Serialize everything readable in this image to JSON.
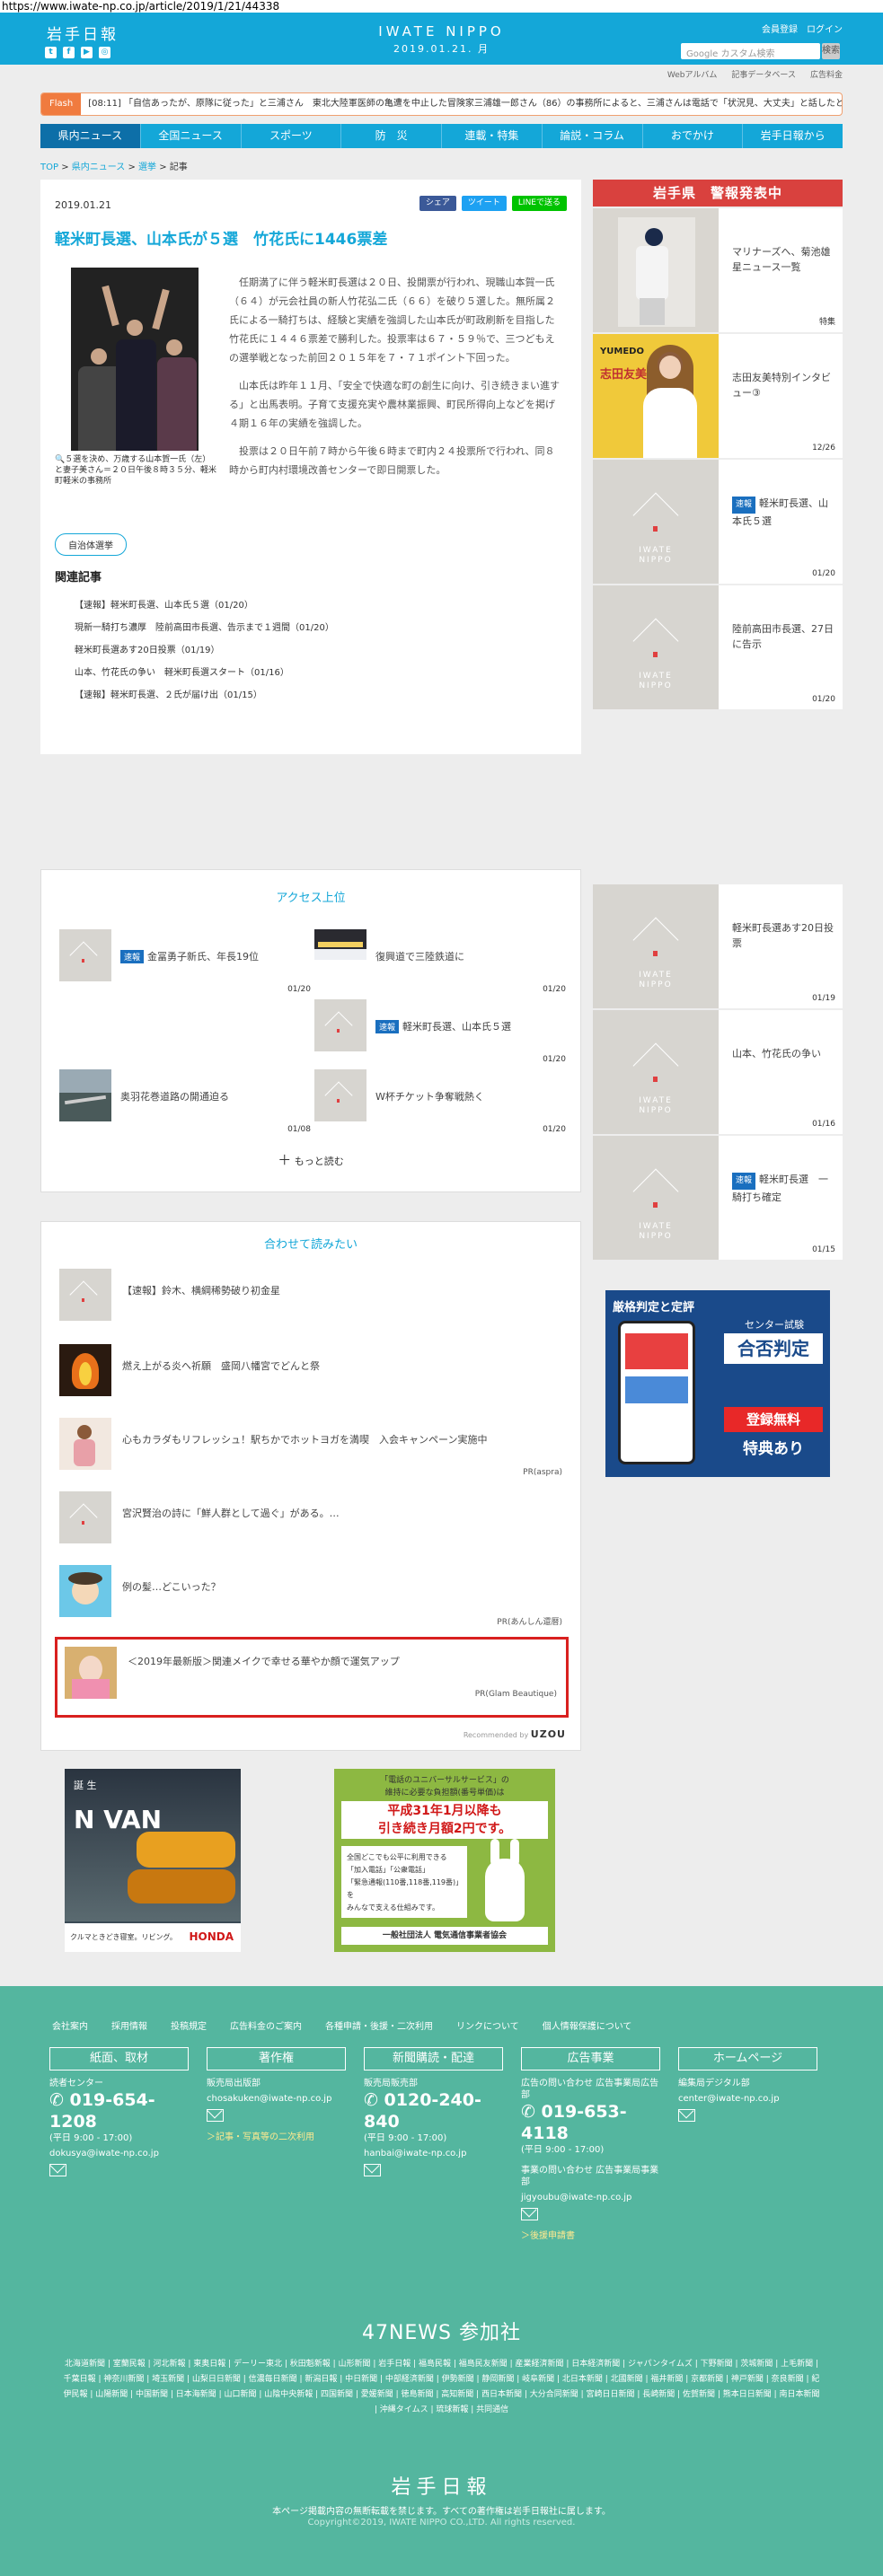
{
  "browser": {
    "url": "https://www.iwate-np.co.jp/article/2019/1/21/44338"
  },
  "header": {
    "logo": "岩手日報",
    "site_name": "IWATE NIPPO",
    "date": "2019.01.21. 月",
    "login_links": [
      "会員登録",
      "ログイン"
    ],
    "search_placeholder": "Google カスタム検索",
    "search_button": "検索",
    "sub_links": [
      "Webアルバム",
      "記事データベース",
      "広告料金"
    ]
  },
  "flash": {
    "label": "Flash",
    "text": "[08:11] 「自信あったが、原隊に従った」と三浦さん　東北大陸軍医師の亀遭を中止した冒険家三浦雄一郎さん（86）の事務所によると、三浦さんは電話で「状況見、大丈夫」と話したという。"
  },
  "nav": {
    "items": [
      "県内ニュース",
      "全国ニュース",
      "スポーツ",
      "防　災",
      "連載・特集",
      "論説・コラム",
      "おでかけ",
      "岩手日報から"
    ],
    "active_index": 0
  },
  "breadcrumb": {
    "top": "TOP",
    "cat": "県内ニュース",
    "sub": "選挙",
    "current": "記事"
  },
  "article": {
    "date": "2019.01.21",
    "share": [
      "シェア",
      "ツイート",
      "LINEで送る"
    ],
    "title": "軽米町長選、山本氏が５選　竹花氏に1446票差",
    "caption": "５選を決め、万歳する山本賀一氏（左）と妻子美さん＝２０日午後８時３５分、軽米町軽米の事務所",
    "paragraphs": [
      "任期満了に伴う軽米町長選は２０日、投開票が行われ、現職山本賀一氏（６４）が元会社員の新人竹花弘二氏（６６）を破り５選した。無所属２氏による一騎打ちは、経験と実績を強調した山本氏が町政刷新を目指した竹花氏に１４４６票差で勝利した。投票率は６７・５９％で、三つどもえの選挙戦となった前回２０１５年を７・７１ポイント下回った。",
      "山本氏は昨年１１月、「安全で快適な町の創生に向け、引き続きまい進する」と出馬表明。子育て支援充実や農林業振興、町民所得向上などを掲げ４期１６年の実績を強調した。",
      "投票は２０日午前７時から午後６時まで町内２４投票所で行われ、同８時から町内村環境改善センターで即日開票した。"
    ],
    "tag": "自治体選挙",
    "related_heading": "関連記事",
    "related": [
      "【速報】軽米町長選、山本氏５選（01/20）",
      "現新一騎打ち濃厚　陸前高田市長選、告示まで１週間（01/20）",
      "軽米町長選あす20日投票（01/19）",
      "山本、竹花氏の争い　軽米町長選スタート（01/16）",
      "【速報】軽米町長選、２氏が届け出（01/15）"
    ]
  },
  "sidebar": {
    "alert": "岩手県　警報発表中",
    "items": [
      {
        "text": "マリナーズへ、菊池雄星ニュース一覧",
        "date": "特集"
      },
      {
        "text": "志田友美特別インタビュー③",
        "date": "12/26"
      },
      {
        "badge": "速報",
        "text": "軽米町長選、山本氏５選",
        "date": "01/20"
      },
      {
        "text": "陸前高田市長選、27日に告示",
        "date": "01/20"
      }
    ],
    "items2": [
      {
        "text": "軽米町長選あす20日投票",
        "date": "01/19"
      },
      {
        "text": "山本、竹花氏の争い",
        "date": "01/16"
      },
      {
        "badge": "速報",
        "text": "軽米町長選　一騎打ち確定",
        "date": "01/15"
      }
    ],
    "placeholder_label_1": "IWATE",
    "placeholder_label_2": "NIPPO",
    "yumedo_logo": "YUMEDO",
    "yumedo_name": "志田友美",
    "ad_top": "厳格判定と定評",
    "ad_title": "合否判定",
    "ad_sub": "センター試験",
    "ad_cta1": "登録無料",
    "ad_cta2": "特典あり"
  },
  "access": {
    "heading": "アクセス上位",
    "items": [
      {
        "badge": "速報",
        "text": "金冨勇子新氏、年長19位",
        "date": "01/20"
      },
      {
        "text": "復興道で三陸鉄道に",
        "date": "01/20"
      },
      {
        "badge": "速報",
        "text": "軽米町長選、山本氏５選",
        "date": "01/20"
      },
      {
        "text": "奥羽花巻道路の開通迫る",
        "date": "01/08"
      },
      {
        "text": "W杯チケット争奪戦熱く",
        "date": "01/20"
      }
    ],
    "more": "もっと読む"
  },
  "recommend": {
    "heading": "合わせて読みたい",
    "items": [
      {
        "text": "【速報】鈴木、横綱稀勢破り初金星",
        "pr": ""
      },
      {
        "text": "燃え上がる炎へ祈願　盛岡八幡宮でどんと祭",
        "pr": ""
      },
      {
        "text": "心もカラダもリフレッシュ！駅ちかでホットヨガを満喫　入会キャンペーン実施中",
        "pr": "PR(aspra)"
      },
      {
        "text": "宮沢賢治の詩に「鮮人群として過ぐ」がある。…",
        "pr": ""
      },
      {
        "text": "例の髪…どこいった？",
        "pr": "PR(あんしん還暦)"
      },
      {
        "text": "＜2019年最新版＞関連メイクで幸せる華やか顔で運気アップ",
        "pr": "PR(Glam Beautique)"
      }
    ],
    "powered": "Recommended by",
    "powered_brand": "UZOU"
  },
  "ads": {
    "honda_brand": "HONDA",
    "honda_model": "N VAN",
    "honda_tagline": "クルマときどき寝室。リビング。",
    "honda_sub": "誕 生",
    "univ_text1": "「電話のユニバーサルサービス」の",
    "univ_text2": "維持に必要な負担額(番号単価)は",
    "univ_text3": "平成31年1月以降も",
    "univ_text4": "引き続き月額2円です。",
    "univ_text5": "全国どこでも公平に利用できる",
    "univ_text6": "「加入電話」「公衆電話」",
    "univ_text7": "「緊急通報(110番,118番,119番)」を",
    "univ_text8": "みんなで支える仕組みです。",
    "univ_org": "一般社団法人 電気通信事業者協会"
  },
  "footer": {
    "nav": [
      "会社案内",
      "採用情報",
      "投稿規定",
      "広告料金のご案内",
      "各種申請・後援・二次利用",
      "リンクについて",
      "個人情報保護について"
    ],
    "boxes": [
      {
        "title": "紙面、取材",
        "label": "読者センター",
        "phone": "019-654-1208",
        "hours": "(平日 9:00 - 17:00)",
        "email": "dokusya@iwate-np.co.jp",
        "link": ""
      },
      {
        "title": "著作権",
        "label": "販売局出版部",
        "phone": "",
        "hours": "",
        "email": "chosakuken@iwate-np.co.jp",
        "link": "＞記事・写真等の二次利用"
      },
      {
        "title": "新聞購読・配達",
        "label": "販売局販売部",
        "phone": "0120-240-840",
        "hours": "(平日 9:00 - 17:00)",
        "email": "hanbai@iwate-np.co.jp",
        "link": ""
      },
      {
        "title": "広告事業",
        "label": "広告の問い合わせ 広告事業局広告部",
        "phone": "019-653-4118",
        "hours": "(平日 9:00 - 17:00)",
        "email": "jigyoubu@iwate-np.co.jp",
        "label2": "事業の問い合わせ 広告事業局事業部",
        "link": "＞後援申請書"
      },
      {
        "title": "ホームページ",
        "label": "編集局デジタル部",
        "phone": "",
        "hours": "",
        "email": "center@iwate-np.co.jp",
        "link": ""
      }
    ],
    "forty7": "47NEWS 参加社",
    "papers": "北海道新聞 | 室蘭民報 | 河北新報 | 東奥日報 | デーリー東北 | 秋田魁新報 | 山形新聞 | 岩手日報 | 福島民報 | 福島民友新聞 | 産業経済新聞 | 日本経済新聞 | ジャパンタイムズ | 下野新聞 | 茨城新聞 | 上毛新聞 | 千葉日報 | 神奈川新聞 | 埼玉新聞 | 山梨日日新聞 | 信濃毎日新聞 | 新潟日報 | 中日新聞 | 中部経済新聞 | 伊勢新聞 | 静岡新聞 | 岐阜新聞 | 北日本新聞 | 北國新聞 | 福井新聞 | 京都新聞 | 神戸新聞 | 奈良新聞 | 紀伊民報 | 山陽新聞 | 中国新聞 | 日本海新聞 | 山口新聞 | 山陰中央新報 | 四国新聞 | 愛媛新聞 | 徳島新聞 | 高知新聞 | 西日本新聞 | 大分合同新聞 | 宮崎日日新聞 | 長崎新聞 | 佐賀新聞 | 熊本日日新聞 | 南日本新聞 | 沖縄タイムス | 琉球新報 | 共同通信",
    "logo": "岩手日報",
    "notice": "本ページ掲載内容の無断転載を禁じます。すべての著作権は岩手日報社に属します。",
    "copyright": "Copyright©2019, IWATE NIPPO CO.,LTD. All rights reserved."
  },
  "colors": {
    "brand": "#14a7d8",
    "nav_active": "#0d6fa8",
    "alert": "#d9413e",
    "footer": "#54b69f",
    "flash": "#f07b3f"
  }
}
